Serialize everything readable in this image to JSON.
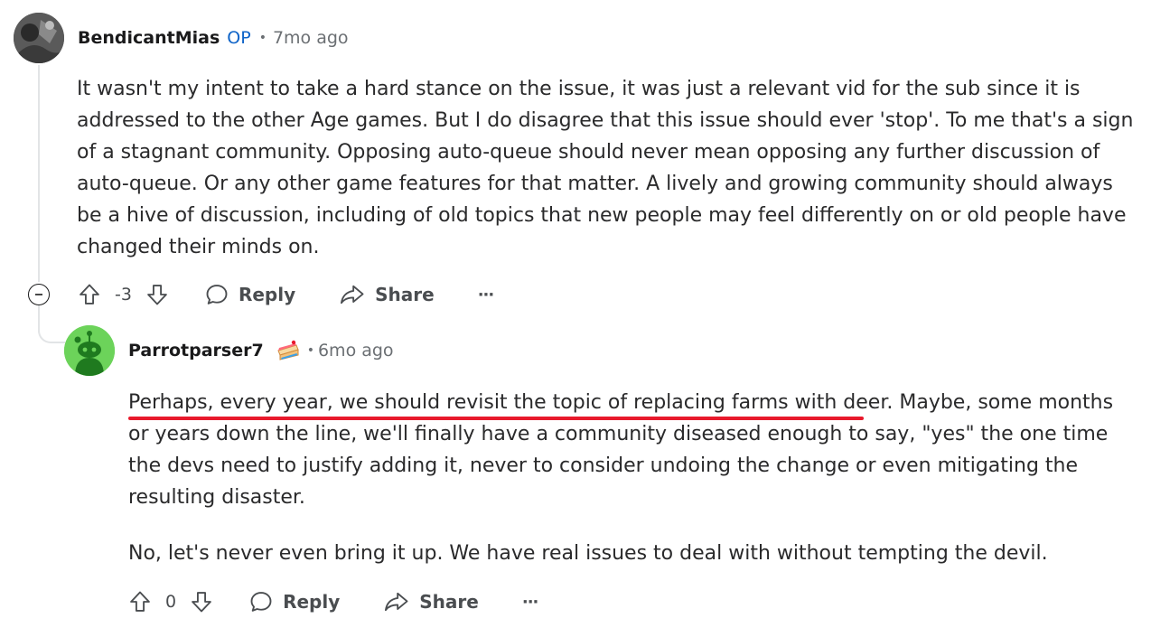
{
  "comments": [
    {
      "username": "BendicantMias",
      "op_badge": "OP",
      "separator": "•",
      "time": "7mo ago",
      "paragraphs": [
        "It wasn't my intent to take a hard stance on the issue, it was just a relevant vid for the sub since it is addressed to the other Age games. But I do disagree that this issue should ever 'stop'. To me that's a sign of a stagnant community. Opposing auto-queue should never mean opposing any further discussion of auto-queue. Or any other game features for that matter. A lively and growing community should always be a hive of discussion, including of old topics that new people may feel differently on or old people have changed their minds on."
      ],
      "votes": "-3",
      "reply_label": "Reply",
      "share_label": "Share",
      "more_label": "···"
    },
    {
      "username": "Parrotparser7",
      "flair_icon": "cake-icon",
      "separator": "•",
      "time": "6mo ago",
      "highlight_text": "Perhaps, every year, we should revisit the topic of replacing farms with deer",
      "highlight_color": "#e8192c",
      "paragraph1_rest": ". Maybe, some months or years down the line, we'll finally have a community diseased enough to say, \"yes\" the one time the devs need to justify adding it, never to consider undoing the change or even mitigating the resulting disaster.",
      "paragraph2": "No, let's never even bring it up. We have real issues to deal with without tempting the devil.",
      "votes": "0",
      "reply_label": "Reply",
      "share_label": "Share",
      "more_label": "···"
    }
  ],
  "colors": {
    "op": "#0f64c8",
    "meta": "#6b6f73",
    "avatar_green": "#6cd35a",
    "avatar_robot": "#1f7a1f"
  }
}
